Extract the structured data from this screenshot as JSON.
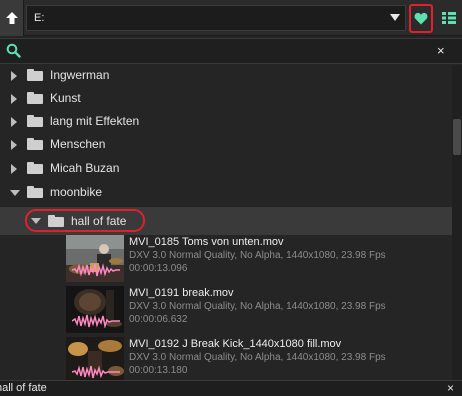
{
  "toolbar": {
    "path_value": "E:",
    "up_icon": "arrow-up-icon",
    "dropdown_icon": "chevron-down-icon",
    "favorite_icon": "heart-icon",
    "view_icon": "list-grid-icon",
    "accent": "#5fe0b0",
    "highlight": "#e0202b"
  },
  "search": {
    "value": "",
    "placeholder": "",
    "search_icon": "search-icon",
    "clear_label": "×"
  },
  "tree": {
    "folders": [
      {
        "label": "Ingwerman",
        "expanded": false
      },
      {
        "label": "Kunst",
        "expanded": false
      },
      {
        "label": "lang mit Effekten",
        "expanded": false
      },
      {
        "label": "Menschen",
        "expanded": false
      },
      {
        "label": "Micah Buzan",
        "expanded": false
      },
      {
        "label": "moonbike",
        "expanded": true
      }
    ],
    "selected_folder": {
      "label": "hall of fate",
      "expanded": true
    }
  },
  "media": [
    {
      "name": "MVI_0185 Toms von unten.mov",
      "meta": "DXV 3.0 Normal Quality, No Alpha, 1440x1080, 23.98 Fps",
      "duration": "00:00:13.096"
    },
    {
      "name": "MVI_0191 break.mov",
      "meta": "DXV 3.0 Normal Quality, No Alpha, 1440x1080, 23.98 Fps",
      "duration": "00:00:06.632"
    },
    {
      "name": "MVI_0192 J Break Kick_1440x1080 fill.mov",
      "meta": "DXV 3.0 Normal Quality, No Alpha, 1440x1080, 23.98 Fps",
      "duration": "00:00:13.180"
    }
  ],
  "status": {
    "text": "hall of fate",
    "close_label": "×"
  }
}
